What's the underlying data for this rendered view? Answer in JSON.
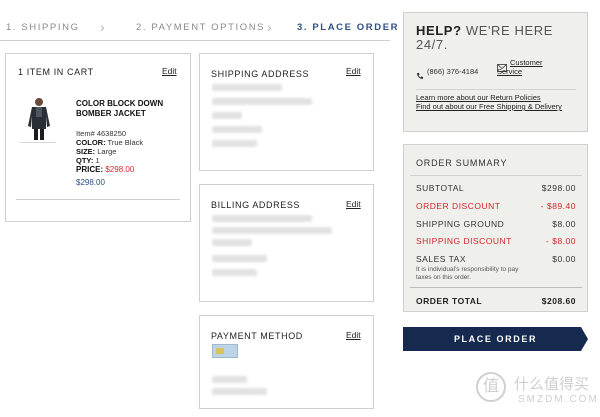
{
  "steps": [
    {
      "label": "1. SHIPPING"
    },
    {
      "label": "2. PAYMENT OPTIONS"
    },
    {
      "label": "3. PLACE ORDER"
    }
  ],
  "cart": {
    "title": "1 ITEM IN CART",
    "edit": "Edit",
    "item": {
      "name": "COLOR BLOCK DOWN BOMBER JACKET",
      "item_no": "Item# 4638250",
      "color_label": "COLOR:",
      "color_value": "True Black",
      "size_label": "SIZE:",
      "size_value": "Large",
      "qty_label": "QTY:",
      "qty_value": "1",
      "price_label": "PRICE:",
      "price_value": "$298.00",
      "total": "$298.00"
    }
  },
  "shipping": {
    "title": "SHIPPING ADDRESS",
    "edit": "Edit"
  },
  "billing": {
    "title": "BILLING ADDRESS",
    "edit": "Edit"
  },
  "payment": {
    "title": "PAYMENT METHOD",
    "edit": "Edit"
  },
  "help": {
    "title_bold": "HELP?",
    "title_rest": " WE'RE HERE",
    "title_line2": "24/7.",
    "phone": "(866) 376-4184",
    "customer_service": "Customer Service",
    "returns_link": "Learn more about our Return Policies",
    "shipping_link": "Find out about our Free Shipping & Delivery"
  },
  "summary": {
    "title": "ORDER SUMMARY",
    "rows": [
      {
        "label": "SUBTOTAL",
        "value": "$298.00"
      },
      {
        "label": "ORDER DISCOUNT",
        "value": "- $89.40"
      },
      {
        "label": "SHIPPING GROUND",
        "value": "$8.00"
      },
      {
        "label": "SHIPPING DISCOUNT",
        "value": "- $8.00"
      },
      {
        "label": "SALES TAX",
        "value": "$0.00"
      }
    ],
    "tax_note": "It is individual's responsibility to pay taxes on this order.",
    "total_label": "ORDER TOTAL",
    "total_value": "$208.60"
  },
  "place_order_label": "PLACE ORDER",
  "watermark": {
    "text": "什么值得买",
    "sub": "SMZDM.COM",
    "badge": "值"
  },
  "colors": {
    "accent_blue": "#2f4f86",
    "discount_red": "#d7262e",
    "button_navy": "#162a4f",
    "panel_gray": "#efefec"
  }
}
